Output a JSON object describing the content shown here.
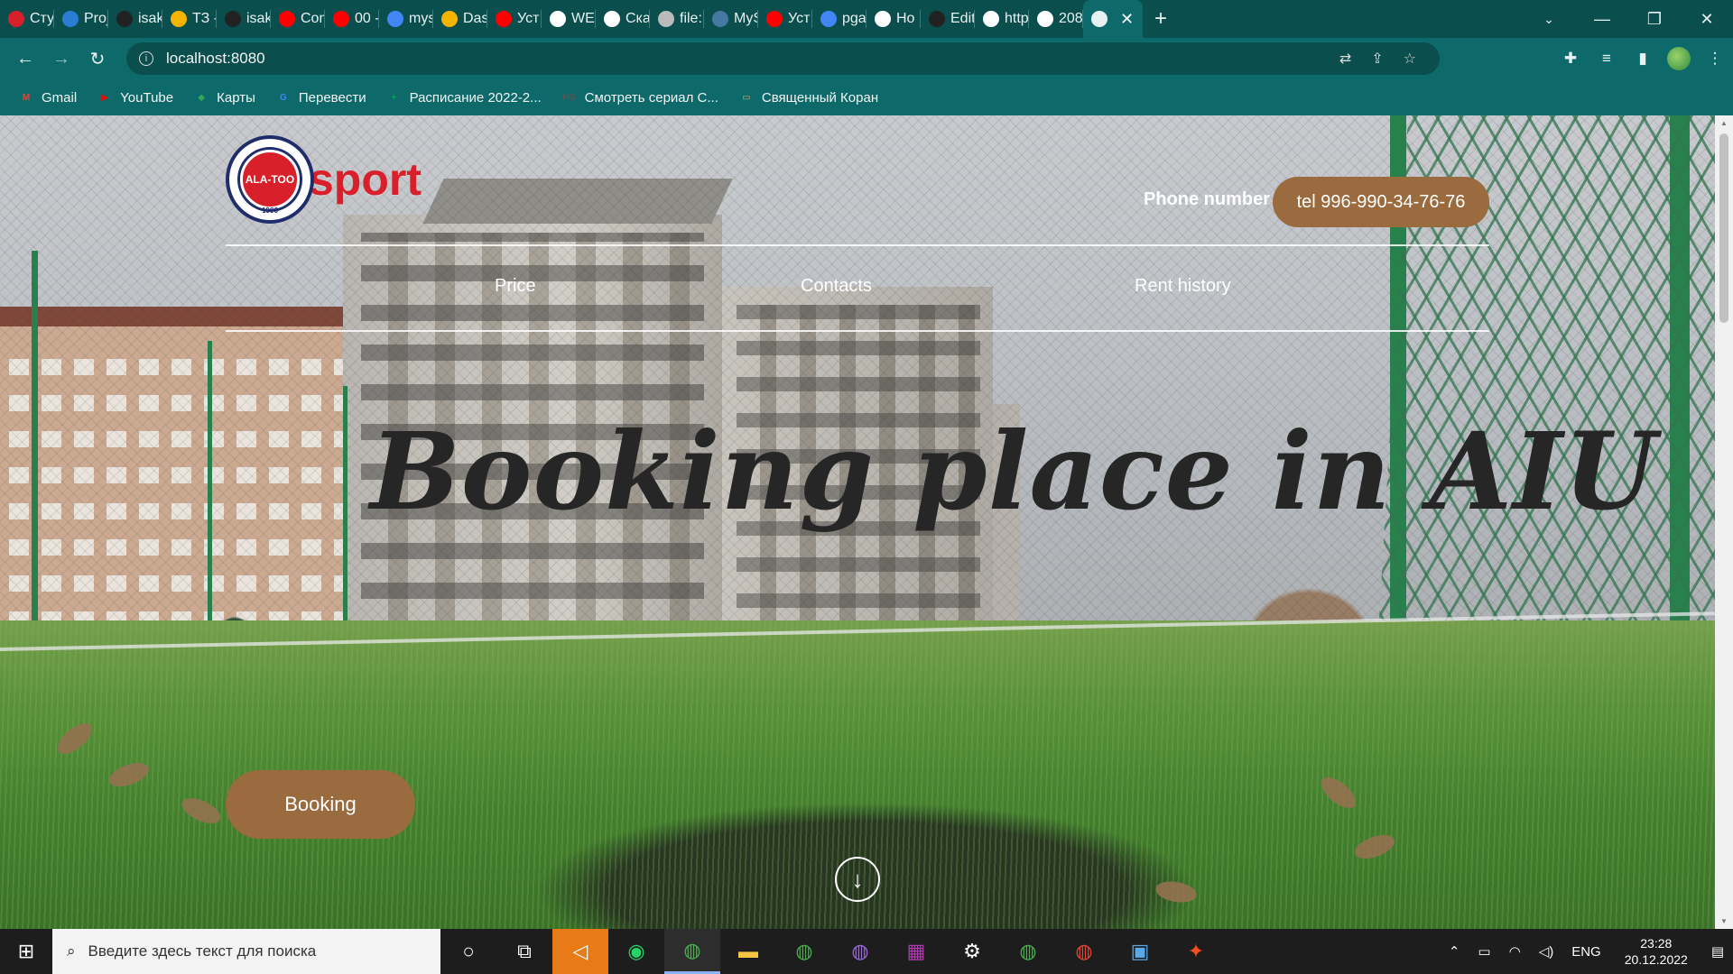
{
  "browser": {
    "tabs": [
      {
        "title": "Сту",
        "icon": "circle-red",
        "color": "#d8202a"
      },
      {
        "title": "Proj",
        "icon": "doc-blue",
        "color": "#2b7cd3"
      },
      {
        "title": "isak",
        "icon": "github",
        "color": "#222222"
      },
      {
        "title": "ТЗ -",
        "icon": "drive",
        "color": "#f4b400"
      },
      {
        "title": "isak",
        "icon": "github",
        "color": "#222222"
      },
      {
        "title": "Con",
        "icon": "youtube",
        "color": "#ff0000"
      },
      {
        "title": "00 -",
        "icon": "youtube",
        "color": "#ff0000"
      },
      {
        "title": "mys",
        "icon": "google",
        "color": "#4285f4"
      },
      {
        "title": "Das",
        "icon": "chart",
        "color": "#f4b400"
      },
      {
        "title": "Уст",
        "icon": "youtube",
        "color": "#ff0000"
      },
      {
        "title": "WEI",
        "icon": "globe",
        "color": "#ffffff"
      },
      {
        "title": "Ска",
        "icon": "download",
        "color": "#ffffff"
      },
      {
        "title": "file:",
        "icon": "globe",
        "color": "#bbbbbb"
      },
      {
        "title": "MyS",
        "icon": "mysql",
        "color": "#4479a1"
      },
      {
        "title": "Уст",
        "icon": "youtube",
        "color": "#ff0000"
      },
      {
        "title": "pga",
        "icon": "google",
        "color": "#4285f4"
      },
      {
        "title": "Ho",
        "icon": "globe",
        "color": "#ffffff"
      },
      {
        "title": "Edit",
        "icon": "github",
        "color": "#222222"
      },
      {
        "title": "http",
        "icon": "globe",
        "color": "#ffffff"
      },
      {
        "title": "208",
        "icon": "globe",
        "color": "#ffffff"
      }
    ],
    "active_tab_close": "✕",
    "new_tab": "+",
    "url": "localhost:8080",
    "bookmarks": [
      {
        "label": "Gmail",
        "icon": "M",
        "color": "#ea4335"
      },
      {
        "label": "YouTube",
        "icon": "▶",
        "color": "#ff0000"
      },
      {
        "label": "Карты",
        "icon": "◆",
        "color": "#34a853"
      },
      {
        "label": "Перевести",
        "icon": "G",
        "color": "#4285f4"
      },
      {
        "label": "Расписание 2022-2...",
        "icon": "+",
        "color": "#0f9d58"
      },
      {
        "label": "Смотреть сериал С...",
        "icon": "HD",
        "color": "#555555"
      },
      {
        "label": "Священный Коран",
        "icon": "▭",
        "color": "#c9a66b"
      }
    ]
  },
  "site": {
    "logo_text": "sport",
    "logo_seal_text": "ALA-TOO",
    "logo_seal_year": "1996",
    "phone_label": "Phone number",
    "phone_button": "tel 996-990-34-76-76",
    "nav": [
      "Price",
      "Contacts",
      "Rent history"
    ],
    "hero_title": "Booking place in AIU",
    "booking_button": "Booking",
    "scroll_icon": "↓"
  },
  "taskbar": {
    "search_placeholder": "Введите здесь текст для поиска",
    "language": "ENG",
    "time": "23:28",
    "date": "20.12.2022"
  }
}
